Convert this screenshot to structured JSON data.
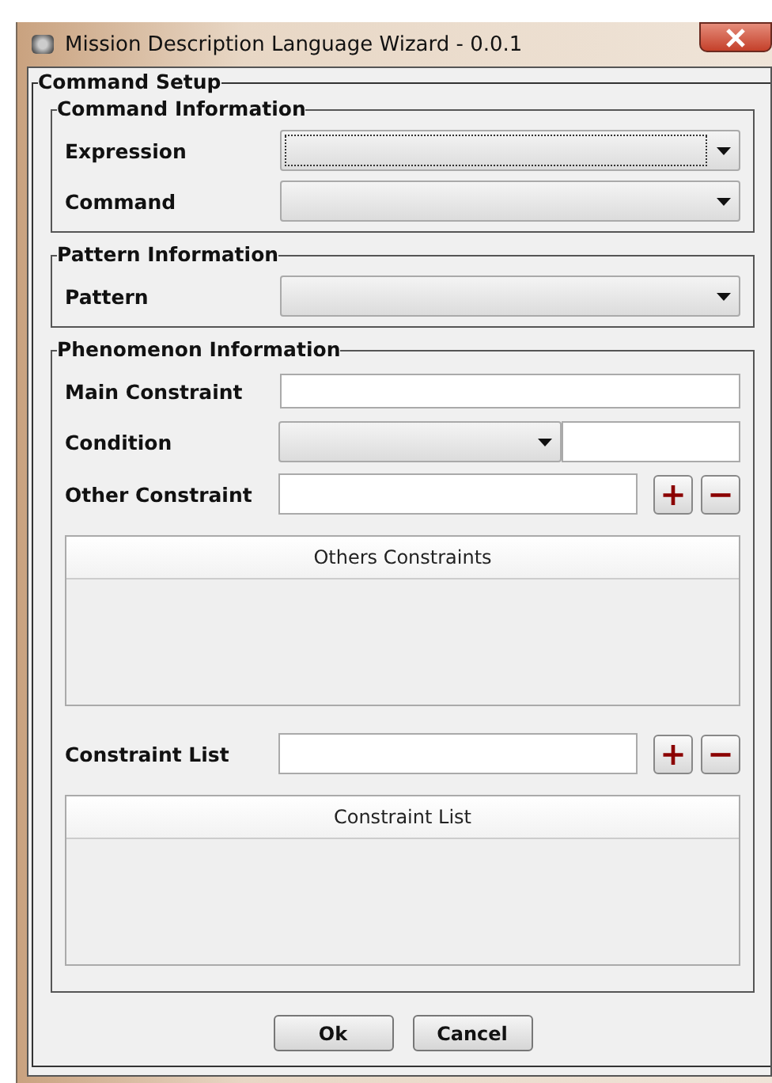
{
  "window": {
    "title": "Mission Description Language Wizard - 0.0.1"
  },
  "panel": {
    "title": "Command Setup",
    "sections": [
      {
        "title": "Command Information",
        "rows": [
          {
            "kind": "combo",
            "label": "Expression",
            "focused": true
          },
          {
            "kind": "combo",
            "label": "Command",
            "focused": false
          }
        ]
      },
      {
        "title": "Pattern Information",
        "rows": [
          {
            "kind": "combo",
            "label": "Pattern",
            "focused": false
          }
        ]
      },
      {
        "title": "Phenomenon Information",
        "rows": [
          {
            "kind": "text",
            "label": "Main Constraint"
          },
          {
            "kind": "condition",
            "label": "Condition"
          },
          {
            "kind": "addremove",
            "label": "Other Constraint",
            "add": "+",
            "remove": "−"
          },
          {
            "kind": "table",
            "header": "Others Constraints"
          },
          {
            "kind": "addremove",
            "label": "Constraint List",
            "add": "+",
            "remove": "−"
          },
          {
            "kind": "table",
            "header": "Constraint List"
          }
        ]
      }
    ]
  },
  "buttons": [
    "Ok",
    "Cancel"
  ]
}
